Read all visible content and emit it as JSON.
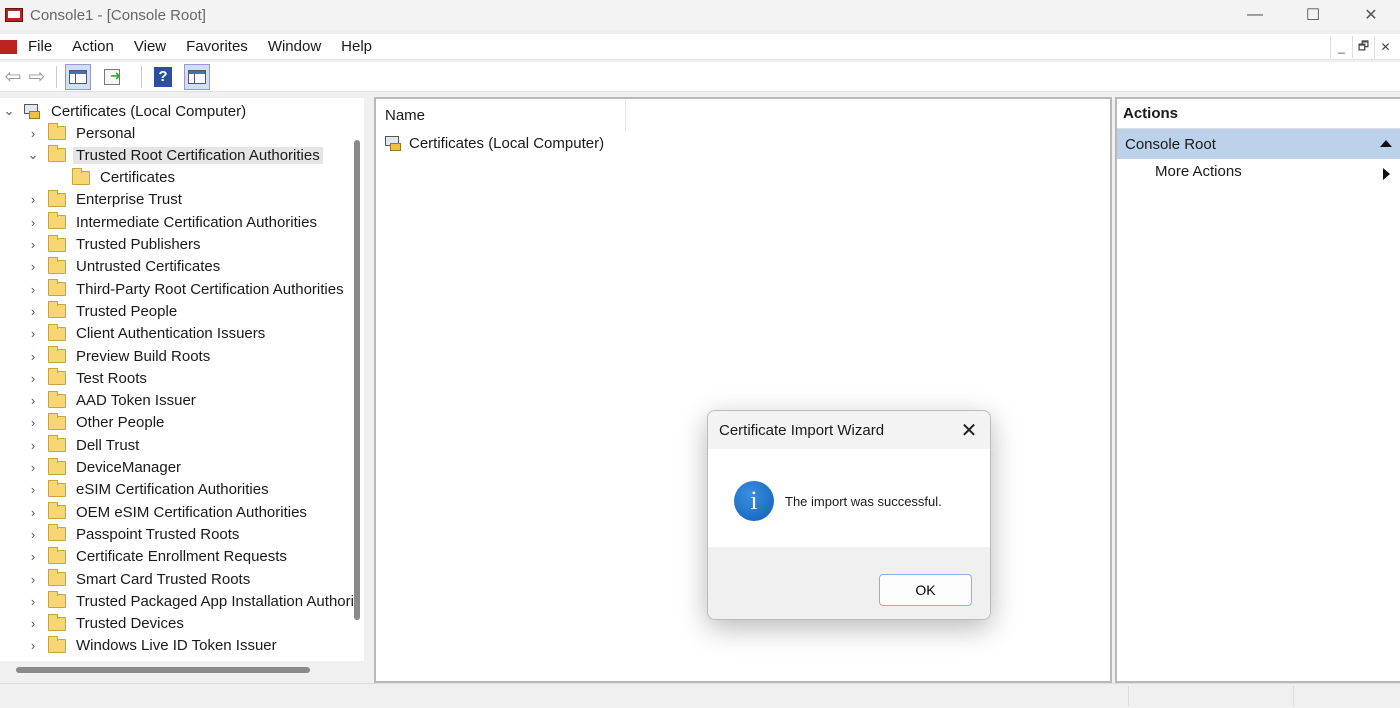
{
  "window": {
    "title": "Console1 - [Console Root]",
    "controls": {
      "minimize": "—",
      "maximize": "☐",
      "close": "✕"
    }
  },
  "menu": {
    "items": [
      "File",
      "Action",
      "View",
      "Favorites",
      "Window",
      "Help"
    ],
    "mdi": {
      "minimize": "_",
      "restore": "🗗",
      "close": "✕"
    }
  },
  "toolbar": {
    "back": "⇦",
    "forward": "⇨",
    "help": "?"
  },
  "tree": {
    "root": "Certificates (Local Computer)",
    "items": [
      {
        "label": "Personal",
        "state": "collapsed"
      },
      {
        "label": "Trusted Root Certification Authorities",
        "state": "expanded",
        "selected": true
      },
      {
        "label": "Certificates",
        "state": "child"
      },
      {
        "label": "Enterprise Trust",
        "state": "collapsed"
      },
      {
        "label": "Intermediate Certification Authorities",
        "state": "collapsed"
      },
      {
        "label": "Trusted Publishers",
        "state": "collapsed"
      },
      {
        "label": "Untrusted Certificates",
        "state": "collapsed"
      },
      {
        "label": "Third-Party Root Certification Authorities",
        "state": "collapsed"
      },
      {
        "label": "Trusted People",
        "state": "collapsed"
      },
      {
        "label": "Client Authentication Issuers",
        "state": "collapsed"
      },
      {
        "label": "Preview Build Roots",
        "state": "collapsed"
      },
      {
        "label": "Test Roots",
        "state": "collapsed"
      },
      {
        "label": "AAD Token Issuer",
        "state": "collapsed"
      },
      {
        "label": "Other People",
        "state": "collapsed"
      },
      {
        "label": "Dell Trust",
        "state": "collapsed"
      },
      {
        "label": "DeviceManager",
        "state": "collapsed"
      },
      {
        "label": "eSIM Certification Authorities",
        "state": "collapsed"
      },
      {
        "label": "OEM eSIM Certification Authorities",
        "state": "collapsed"
      },
      {
        "label": "Passpoint Trusted Roots",
        "state": "collapsed"
      },
      {
        "label": "Certificate Enrollment Requests",
        "state": "collapsed"
      },
      {
        "label": "Smart Card Trusted Roots",
        "state": "collapsed"
      },
      {
        "label": "Trusted Packaged App Installation Authorit",
        "state": "collapsed"
      },
      {
        "label": "Trusted Devices",
        "state": "collapsed"
      },
      {
        "label": "Windows Live ID Token Issuer",
        "state": "collapsed"
      }
    ]
  },
  "center": {
    "column_header": "Name",
    "items": [
      "Certificates (Local Computer)"
    ]
  },
  "actions": {
    "title": "Actions",
    "section": "Console Root",
    "items": [
      "More Actions"
    ]
  },
  "dialog": {
    "title": "Certificate Import Wizard",
    "close": "✕",
    "icon": "info-icon",
    "icon_glyph": "i",
    "message": "The import was successful.",
    "ok_label": "OK"
  },
  "colors": {
    "selection": "#e5e5e5",
    "actions_section": "#bcd2ea",
    "info_icon": "#1a6fcc",
    "folder": "#f7d774"
  }
}
